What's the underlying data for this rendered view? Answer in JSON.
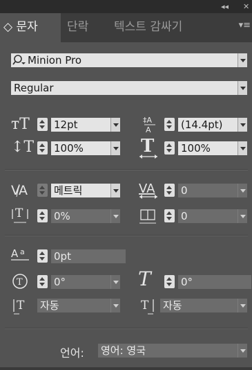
{
  "titlebar": {
    "collapse": "◂◂",
    "close": "✕"
  },
  "tabs": [
    {
      "label": "◇ 문자",
      "active": true
    },
    {
      "label": "단락",
      "active": false
    },
    {
      "label": "텍스트 감싸기",
      "active": false
    }
  ],
  "panel_menu_icon": "▾≡",
  "font": {
    "family": "Minion Pro",
    "style": "Regular"
  },
  "size": {
    "font_size": "12pt",
    "leading": "(14.4pt)"
  },
  "scale": {
    "vertical": "100%",
    "horizontal": "100%"
  },
  "kerning": {
    "value": "메트릭",
    "tracking": "0"
  },
  "tsume": {
    "value": "0%",
    "aki": "0"
  },
  "baseline_shift": "0pt",
  "rotation": "0°",
  "skew": "0°",
  "aki_left": "자동",
  "aki_right": "자동",
  "language": {
    "label": "언어:",
    "value": "영어: 영국"
  }
}
